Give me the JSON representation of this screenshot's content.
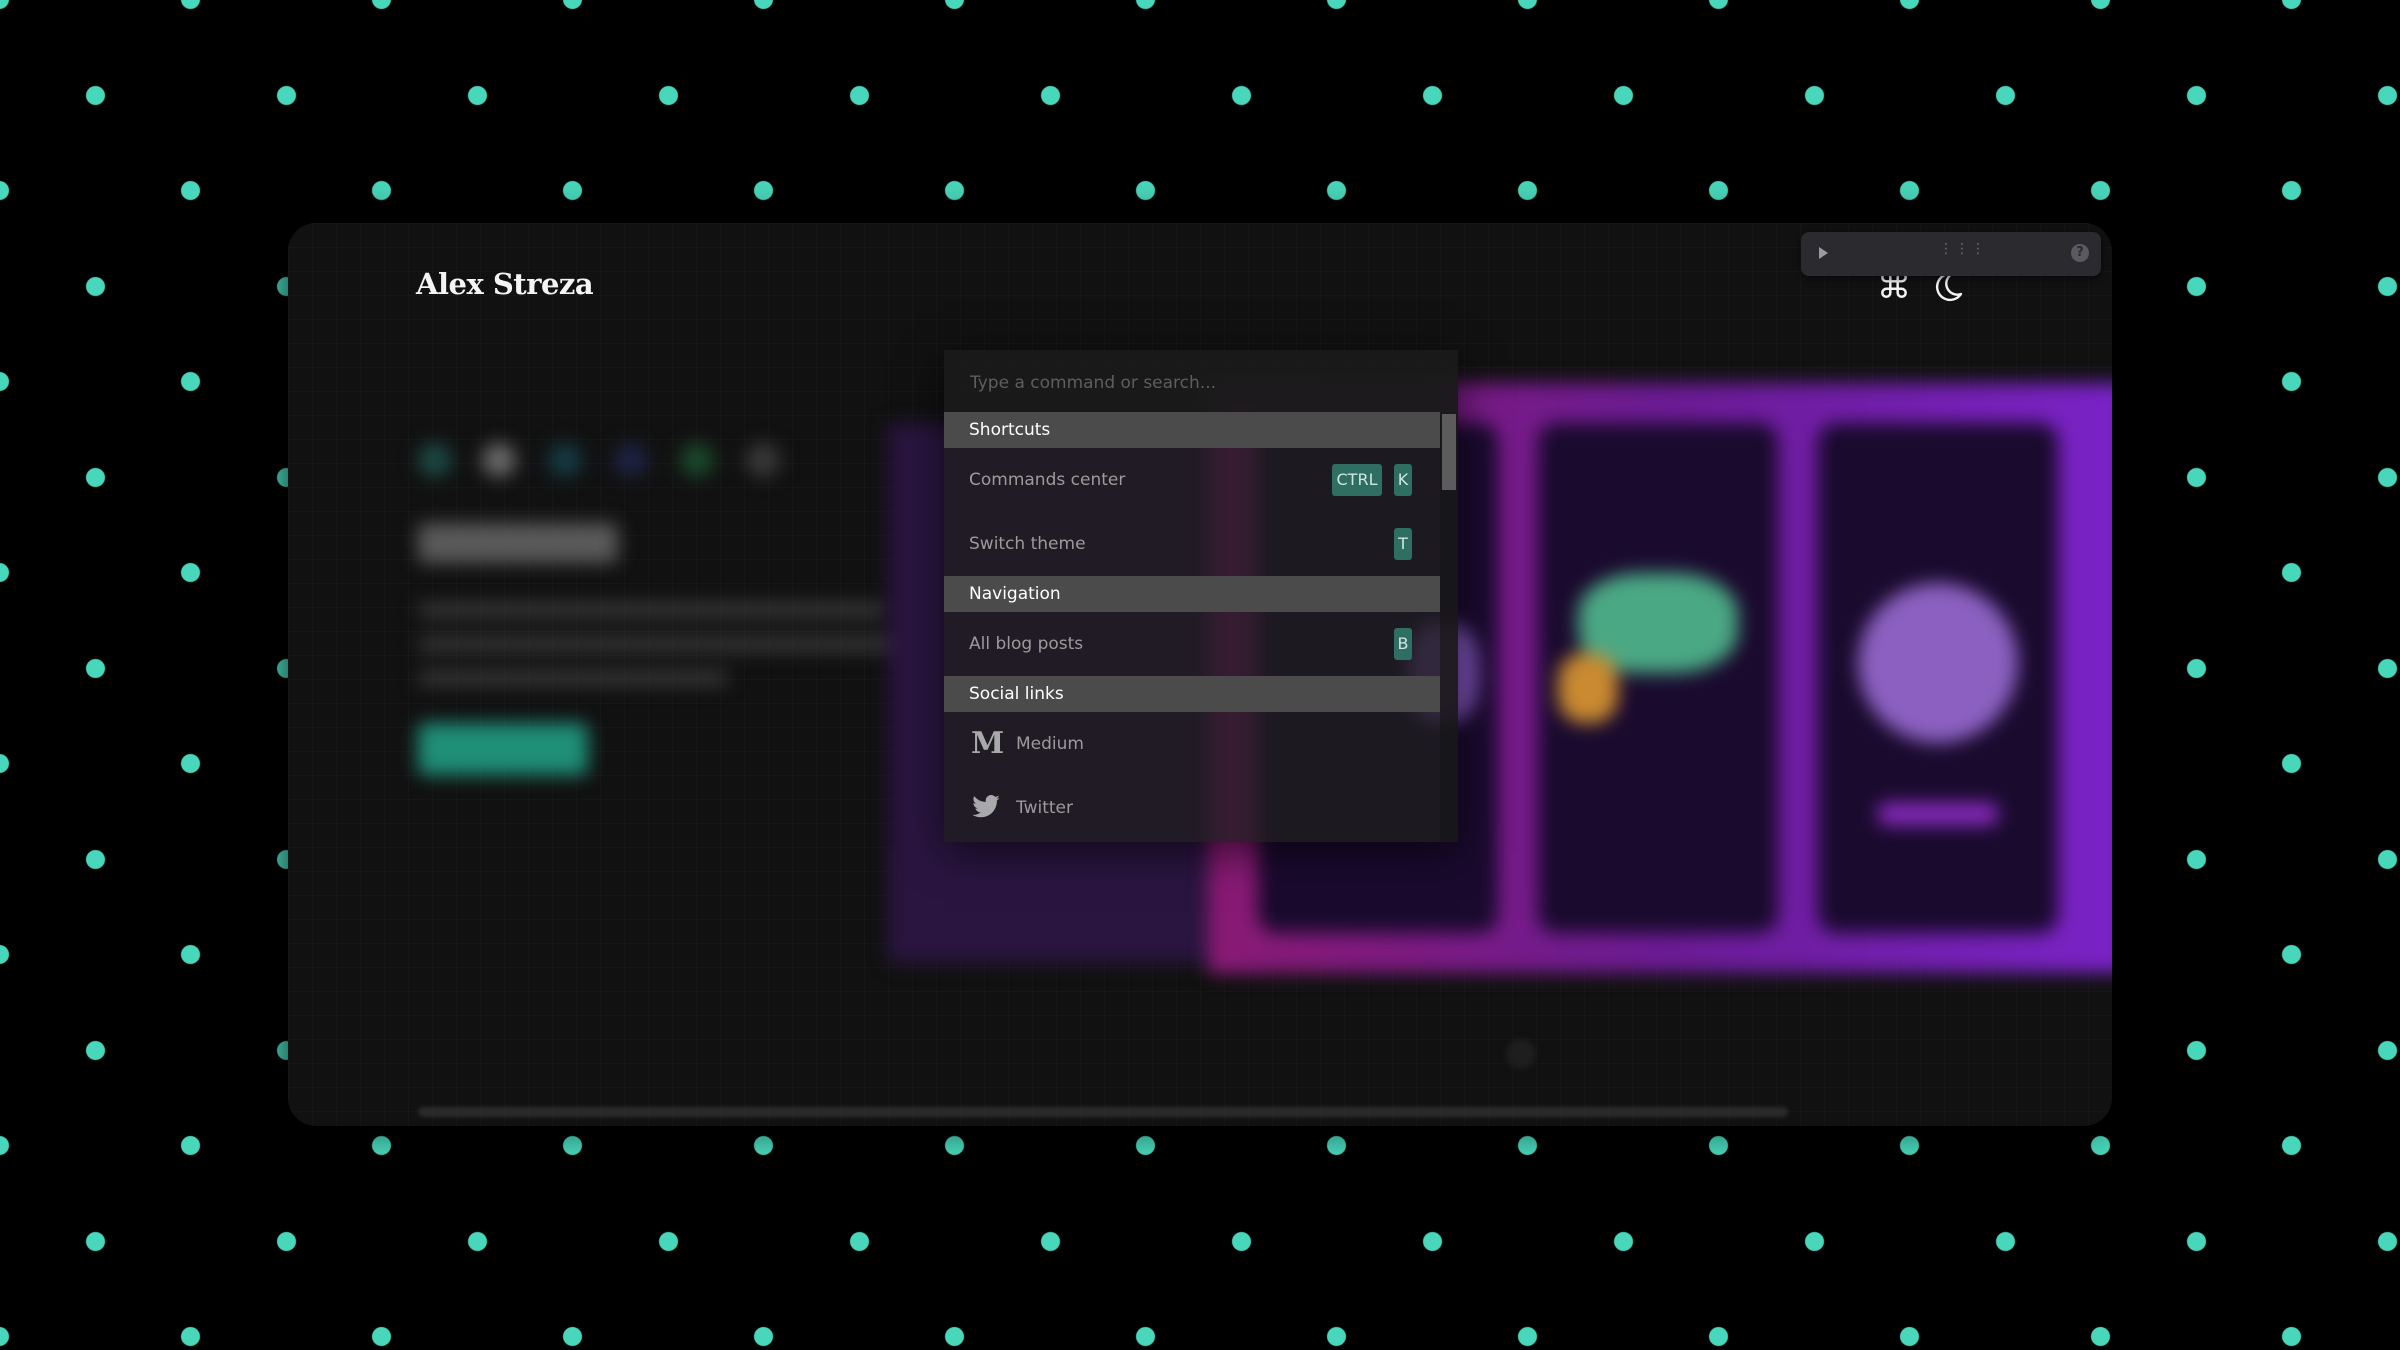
{
  "site": {
    "title": "Alex Streza"
  },
  "header_icons": {
    "command": "command-key-icon",
    "theme": "moon-icon"
  },
  "devbar": {
    "play_icon": "play-icon",
    "grip_icon": "drag-grip-icon",
    "help_icon": "help-icon",
    "grip_glyph": "⋮⋮⋮",
    "help_glyph": "?"
  },
  "palette": {
    "search_placeholder": "Type a command or search...",
    "groups": [
      {
        "title": "Shortcuts",
        "items": [
          {
            "label": "Commands center",
            "keys": [
              "CTRL",
              "K"
            ]
          },
          {
            "label": "Switch theme",
            "keys": [
              "T"
            ]
          }
        ]
      },
      {
        "title": "Navigation",
        "items": [
          {
            "label": "All blog posts",
            "keys": [
              "B"
            ]
          }
        ]
      },
      {
        "title": "Social links",
        "items": [
          {
            "label": "Medium",
            "icon": "medium-icon",
            "glyph": "M"
          },
          {
            "label": "Twitter",
            "icon": "twitter-icon"
          }
        ]
      }
    ]
  },
  "colors": {
    "accent_dots": "#49d7bb",
    "kbd_bg": "#2f6e62",
    "window_bg": "#111111",
    "group_header_bg": "#4b4b4b"
  }
}
